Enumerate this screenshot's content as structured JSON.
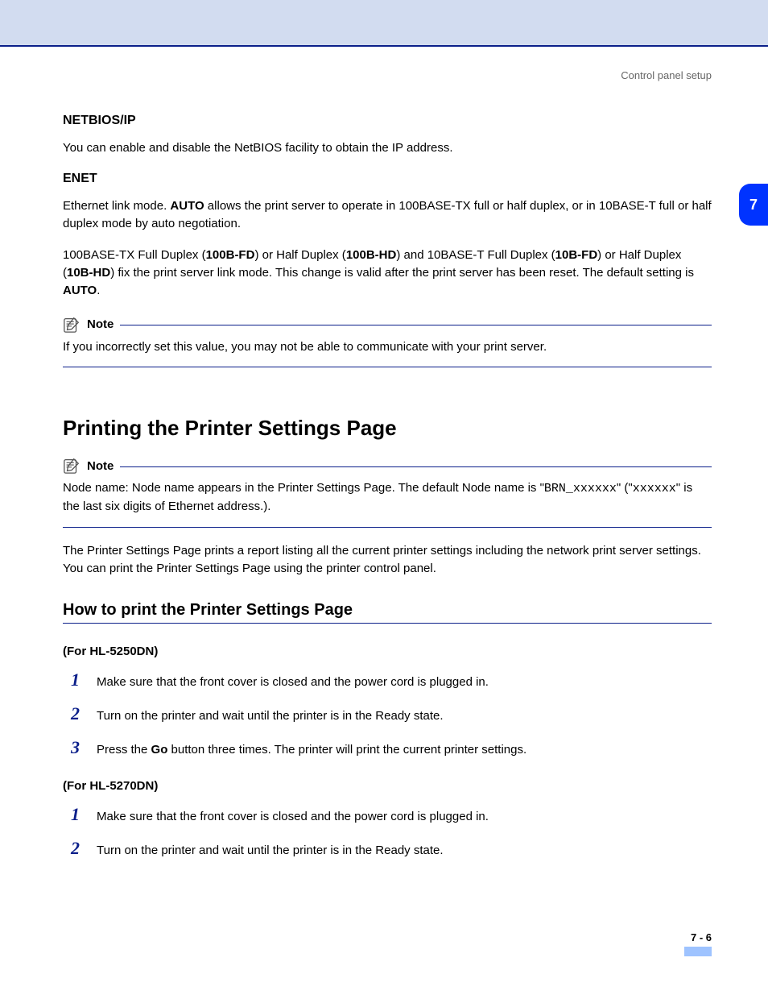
{
  "running_head": "Control panel setup",
  "chapter_tab": "7",
  "netbios": {
    "title": "NETBIOS/IP",
    "body": "You can enable and disable the NetBIOS facility to obtain the IP address."
  },
  "enet": {
    "title": "ENET",
    "p1_a": "Ethernet link mode. ",
    "p1_bold": "AUTO",
    "p1_b": " allows the print server to operate in 100BASE-TX full or half duplex, or in 10BASE-T full or half duplex mode by auto negotiation.",
    "p2_a": "100BASE-TX Full Duplex (",
    "p2_b1": "100B-FD",
    "p2_b": ") or Half Duplex (",
    "p2_b2": "100B-HD",
    "p2_c": ") and 10BASE-T Full Duplex (",
    "p2_b3": "10B-FD",
    "p2_d": ") or Half Duplex (",
    "p2_b4": "10B-HD",
    "p2_e": ") fix the print server link mode. This change is valid after the print server has been reset. The default setting is ",
    "p2_b5": "AUTO",
    "p2_f": "."
  },
  "note1": {
    "label": "Note",
    "body": "If you incorrectly set this value, you may not be able to communicate with your print server."
  },
  "section_title": "Printing the Printer Settings Page",
  "note2": {
    "label": "Note",
    "a": "Node name: Node name appears in the Printer Settings Page. The default Node name is \"",
    "mono1": "BRN_xxxxxx",
    "b": "\" (\"",
    "mono2": "xxxxxx",
    "c": "\" is the last six digits of Ethernet address.)."
  },
  "intro": "The Printer Settings Page prints a report listing all the current printer settings including the network print server settings. You can print the Printer Settings Page using the printer control panel.",
  "subsection_title": "How to print the Printer Settings Page",
  "modelA": {
    "label": "(For HL-5250DN)",
    "steps": [
      "Make sure that the front cover is closed and the power cord is plugged in.",
      "Turn on the printer and wait until the printer is in the Ready state.",
      {
        "a": "Press the ",
        "bold": "Go",
        "b": " button three times. The printer will print the current printer settings."
      }
    ]
  },
  "modelB": {
    "label": "(For HL-5270DN)",
    "steps": [
      "Make sure that the front cover is closed and the power cord is plugged in.",
      "Turn on the printer and wait until the printer is in the Ready state."
    ]
  },
  "page_number": "7 - 6"
}
